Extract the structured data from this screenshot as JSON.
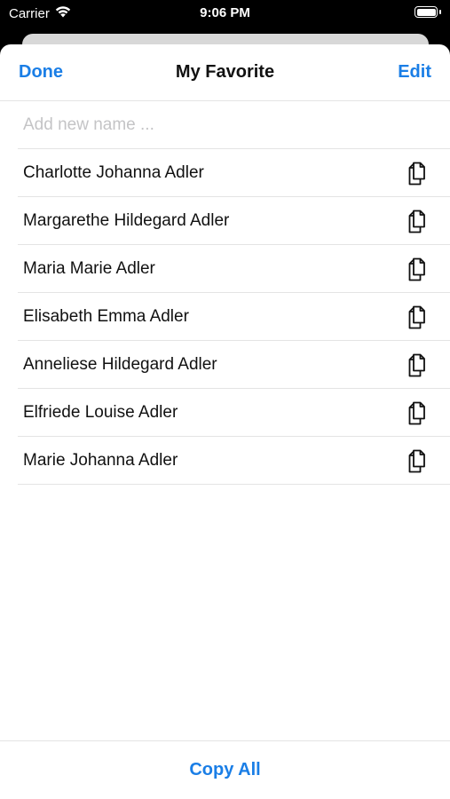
{
  "status_bar": {
    "carrier": "Carrier",
    "time": "9:06 PM"
  },
  "nav": {
    "done_label": "Done",
    "title": "My Favorite",
    "edit_label": "Edit"
  },
  "add_field": {
    "placeholder": "Add new name ...",
    "value": ""
  },
  "names": [
    {
      "name": "Charlotte Johanna Adler",
      "icon": "copy-icon"
    },
    {
      "name": "Margarethe Hildegard Adler",
      "icon": "copy-icon"
    },
    {
      "name": "Maria Marie Adler",
      "icon": "copy-icon"
    },
    {
      "name": "Elisabeth Emma Adler",
      "icon": "copy-icon"
    },
    {
      "name": "Anneliese Hildegard Adler",
      "icon": "copy-icon"
    },
    {
      "name": "Elfriede Louise Adler",
      "icon": "copy-icon"
    },
    {
      "name": "Marie Johanna Adler",
      "icon": "copy-icon"
    }
  ],
  "footer": {
    "copy_all_label": "Copy All"
  },
  "colors": {
    "accent": "#1a7ee6",
    "text": "#111111",
    "placeholder": "#c4c4c6",
    "separator": "#e4e4e4"
  }
}
